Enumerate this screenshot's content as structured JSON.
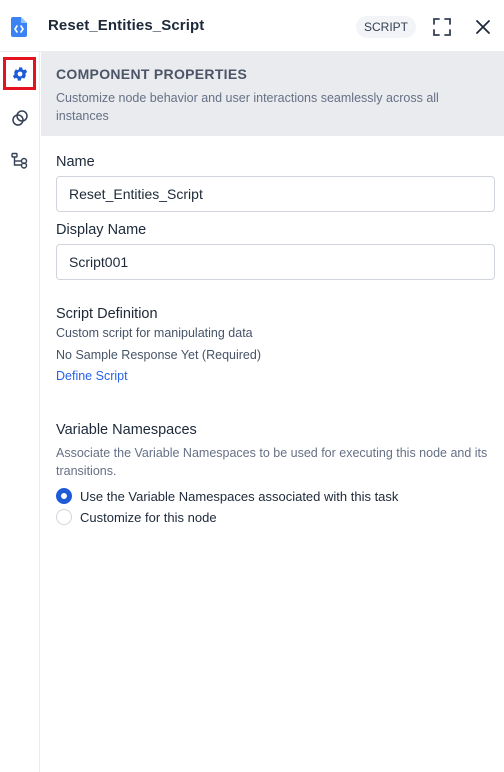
{
  "header": {
    "title": "Reset_Entities_Script",
    "badge": "SCRIPT"
  },
  "rail": {
    "items": [
      {
        "icon": "gear-icon",
        "active": true
      },
      {
        "icon": "link-circles-icon",
        "active": false
      },
      {
        "icon": "branch-flow-icon",
        "active": false
      }
    ]
  },
  "panel": {
    "heading": "COMPONENT PROPERTIES",
    "subheading": "Customize node behavior and user interactions seamlessly across all instances"
  },
  "fields": {
    "name_label": "Name",
    "name_value": "Reset_Entities_Script",
    "display_name_label": "Display Name",
    "display_name_value": "Script001"
  },
  "script_definition": {
    "title": "Script Definition",
    "description": "Custom script for manipulating data",
    "status": "No Sample Response Yet (Required)",
    "link": "Define Script"
  },
  "namespaces": {
    "title": "Variable Namespaces",
    "description": "Associate the Variable Namespaces to be used for executing this node and its transitions.",
    "options": [
      {
        "label": "Use the Variable Namespaces associated with this task",
        "selected": true
      },
      {
        "label": "Customize for this node",
        "selected": false
      }
    ]
  },
  "colors": {
    "accent": "#1d5bd8",
    "highlight": "#e5131f"
  }
}
